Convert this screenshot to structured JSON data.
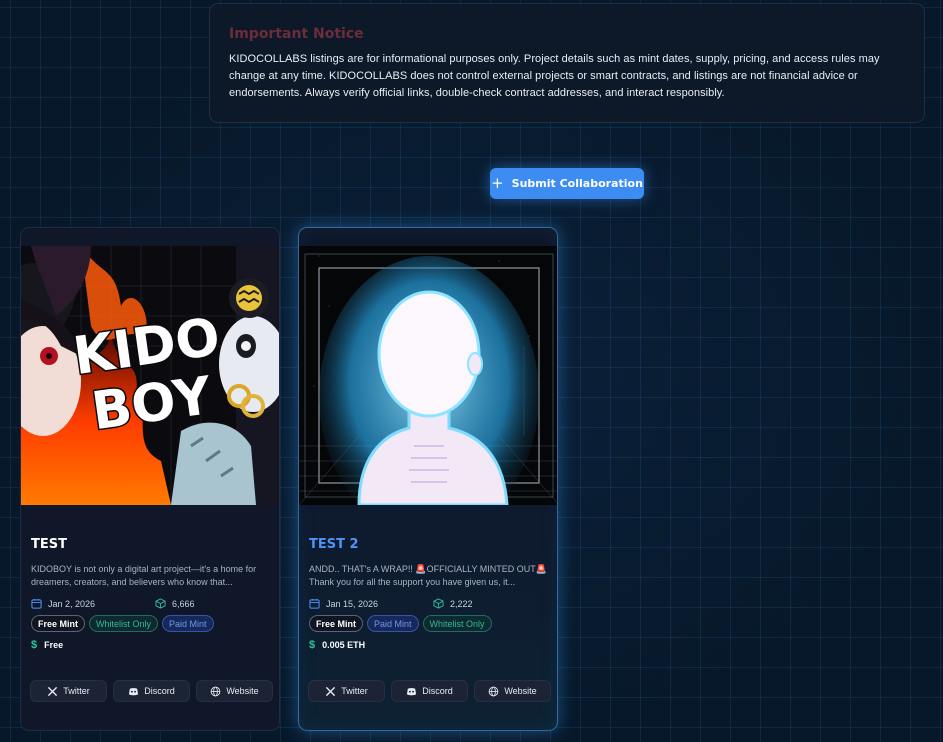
{
  "notice": {
    "title": "Important Notice",
    "body": "KIDOCOLLABS listings are for informational purposes only. Project details such as mint dates, supply, pricing, and access rules may change at any time. KIDOCOLLABS does not control external projects or smart contracts, and listings are not financial advice or endorsements. Always verify official links, double-check contract addresses, and interact responsibly."
  },
  "submit": {
    "label": "Submit Collaboration",
    "icon": "plus-icon"
  },
  "cards": [
    {
      "title": "TEST",
      "desc": "KIDOBOY is not only a digital art project—it's a home for dreamers, creators, and believers who know that...",
      "date": "Jan 2, 2026",
      "supply": "6,666",
      "tags": [
        "Free Mint",
        "Whitelist Only",
        "Paid Mint"
      ],
      "price": "Free",
      "image_text": "KIDO BOY",
      "socials": {
        "twitter": "Twitter",
        "discord": "Discord",
        "website": "Website"
      }
    },
    {
      "title": "TEST 2",
      "desc_line1": "ANDD.. THAT's A WRAP!! 🚨OFFICIALLY MINTED OUT🚨",
      "desc_line2": "Thank you for all the support you have given us, it...",
      "date": "Jan 15, 2026",
      "supply": "2,222",
      "tags": [
        "Free Mint",
        "Paid Mint",
        "Whitelist Only"
      ],
      "price": "0.005 ETH",
      "socials": {
        "twitter": "Twitter",
        "discord": "Discord",
        "website": "Website"
      }
    }
  ],
  "colors": {
    "accent": "#3c8cf2",
    "notice_title": "#6a2d39",
    "whitelist": "#2fb7a8",
    "paid": "#6d98ee",
    "price_icon": "#2fc59b"
  }
}
